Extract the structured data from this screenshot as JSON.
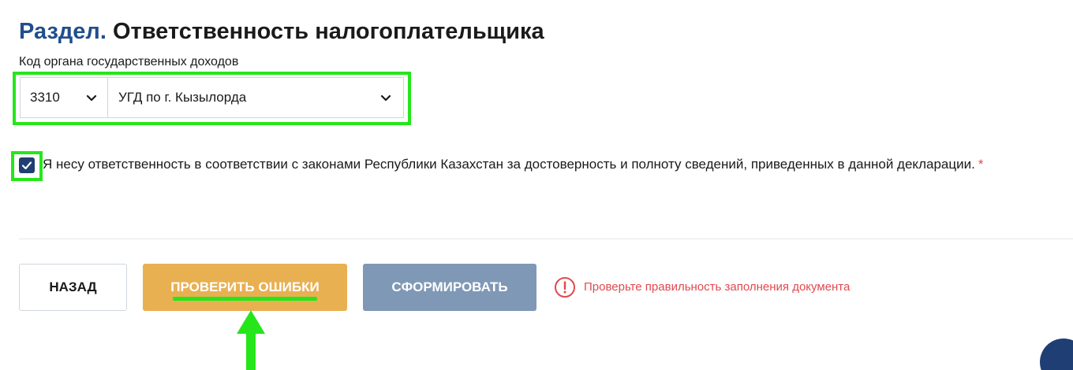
{
  "section": {
    "prefix": "Раздел.",
    "title": "Ответственность налогоплательщика"
  },
  "authority_field": {
    "label": "Код органа государственных доходов",
    "code_value": "3310",
    "name_value": "УГД по г. Кызылорда"
  },
  "declaration": {
    "checked": true,
    "text": "Я несу ответственность в соответствии с законами Республики Казахстан за достоверность и полноту сведений, приведенных в данной декларации.",
    "required_mark": "*"
  },
  "actions": {
    "back_label": "НАЗАД",
    "check_errors_label": "ПРОВЕРИТЬ ОШИБКИ",
    "generate_label": "СФОРМИРОВАТЬ"
  },
  "status": {
    "warning_text": "Проверьте правильность заполнения документа"
  },
  "colors": {
    "title_prefix": "#1f4e8c",
    "highlight": "#25e61b",
    "check_button": "#e9b052",
    "generate_button": "#7f98b5",
    "warning": "#e0494f",
    "checkbox": "#1f3f74"
  },
  "icons": {
    "dropdown": "chevron-down-icon",
    "checkbox": "checkmark-icon",
    "warning": "alert-circle-icon",
    "annotation_arrow": "arrow-up-icon"
  }
}
